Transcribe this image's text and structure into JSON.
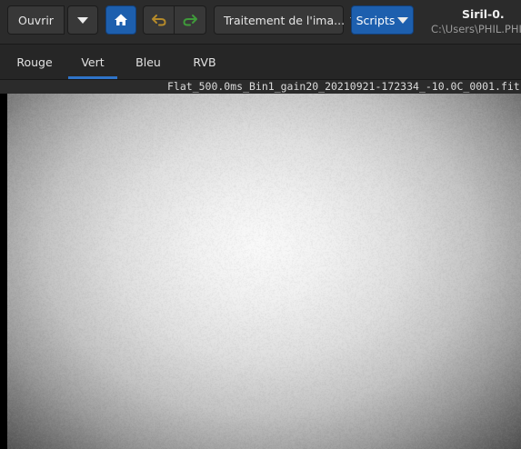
{
  "header": {
    "open_label": "Ouvrir",
    "processing_label": "Traitement de l'ima...",
    "scripts_label": "Scripts",
    "app_title": "Siril-0.",
    "path": "C:\\Users\\PHIL.PHIL"
  },
  "tabs": [
    {
      "label": "Rouge",
      "active": false
    },
    {
      "label": "Vert",
      "active": true
    },
    {
      "label": "Bleu",
      "active": false
    },
    {
      "label": "RVB",
      "active": false
    }
  ],
  "image": {
    "filename": "Flat_500.0ms_Bin1_gain20_20210921-172334_-10.0C_0001.fit"
  },
  "colors": {
    "accent": "#1d5fae",
    "tab_indicator": "#2f74c9",
    "undo_arrow": "#b58a2a",
    "redo_arrow": "#3f9a3a"
  }
}
